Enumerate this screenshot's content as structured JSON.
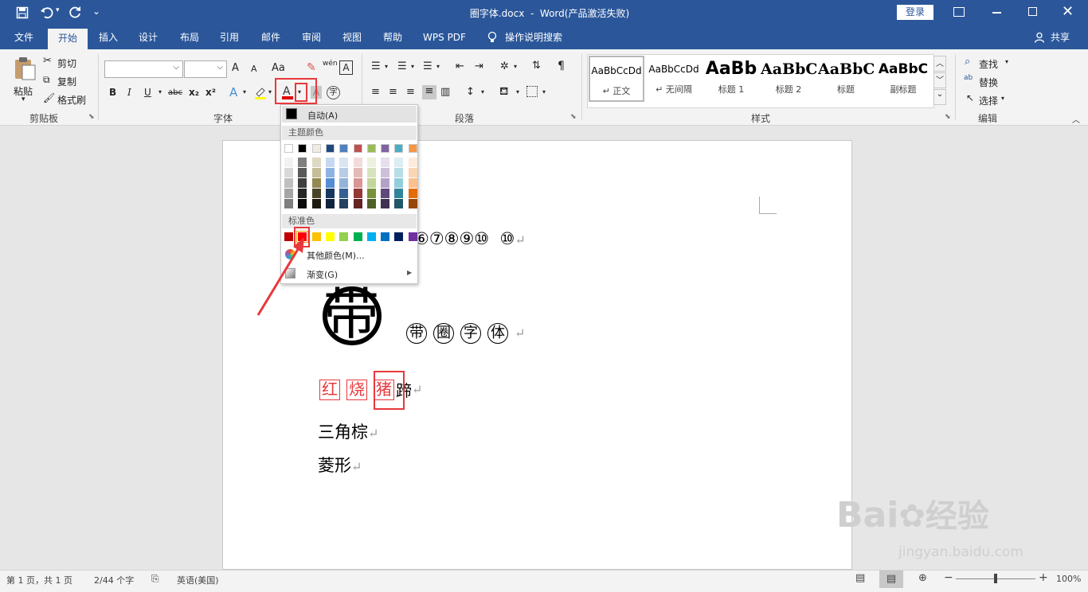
{
  "titlebar": {
    "title": "圈字体.docx  -  Word(产品激活失败)",
    "login": "登录",
    "qat_more": "⌄"
  },
  "tabs": [
    {
      "label": "文件"
    },
    {
      "label": "开始"
    },
    {
      "label": "插入"
    },
    {
      "label": "设计"
    },
    {
      "label": "布局"
    },
    {
      "label": "引用"
    },
    {
      "label": "邮件"
    },
    {
      "label": "审阅"
    },
    {
      "label": "视图"
    },
    {
      "label": "帮助"
    },
    {
      "label": "WPS PDF"
    },
    {
      "label": "操作说明搜索"
    }
  ],
  "share": "共享",
  "clipboard": {
    "paste": "粘贴",
    "cut": "剪切",
    "copy": "复制",
    "format_painter": "格式刷",
    "group": "剪贴板"
  },
  "font": {
    "group": "字体",
    "font_name": "",
    "font_size": "",
    "grow": "A",
    "shrink": "A",
    "change_case": "Aa",
    "phonetic": "wén",
    "bold": "B",
    "italic": "I",
    "underline": "U",
    "strike": "abc",
    "sub": "x₂",
    "sup": "x²",
    "enclose": "字"
  },
  "paragraph": {
    "group": "段落"
  },
  "styles": {
    "group": "样式",
    "items": [
      {
        "sample": "AaBbCcDd",
        "name": "↵ 正文"
      },
      {
        "sample": "AaBbCcDd",
        "name": "↵ 无间隔"
      },
      {
        "sample": "AaBb",
        "name": "标题 1"
      },
      {
        "sample": "AaBbC",
        "name": "标题 2"
      },
      {
        "sample": "AaBbC",
        "name": "标题"
      },
      {
        "sample": "AaBbC",
        "name": "副标题"
      }
    ]
  },
  "editing": {
    "group": "编辑",
    "find": "查找",
    "replace": "替换",
    "select": "选择"
  },
  "color_menu": {
    "auto": "自动(A)",
    "theme_header": "主题颜色",
    "standard_header": "标准色",
    "more": "其他颜色(M)...",
    "gradient": "渐变(G)",
    "theme_top": [
      "#ffffff",
      "#000000",
      "#eeece1",
      "#1f497d",
      "#4f81bd",
      "#c0504d",
      "#9bbb59",
      "#8064a2",
      "#4bacc6",
      "#f79646"
    ],
    "theme_shades": [
      [
        "#f2f2f2",
        "#7f7f7f",
        "#ddd9c3",
        "#c6d9f0",
        "#dbe5f1",
        "#f2dcdb",
        "#ebf1dd",
        "#e5e0ec",
        "#dbeef3",
        "#fdeada"
      ],
      [
        "#d8d8d8",
        "#595959",
        "#c4bd97",
        "#8db3e2",
        "#b8cce4",
        "#e5b9b7",
        "#d7e3bc",
        "#ccc1d9",
        "#b7dde8",
        "#fbd5b5"
      ],
      [
        "#bfbfbf",
        "#3f3f3f",
        "#938953",
        "#548dd4",
        "#95b3d7",
        "#d99694",
        "#c3d69b",
        "#b2a2c7",
        "#92cddc",
        "#fac08f"
      ],
      [
        "#a5a5a5",
        "#262626",
        "#494429",
        "#17365d",
        "#366092",
        "#953734",
        "#76923c",
        "#5f497a",
        "#31859b",
        "#e36c09"
      ],
      [
        "#7f7f7f",
        "#0c0c0c",
        "#1d1b10",
        "#0f243e",
        "#244061",
        "#632423",
        "#4f6128",
        "#3f3151",
        "#205867",
        "#974806"
      ]
    ],
    "standard": [
      "#c00000",
      "#ff0000",
      "#ffc000",
      "#ffff00",
      "#92d050",
      "#00b050",
      "#00b0f0",
      "#0070c0",
      "#002060",
      "#7030a0"
    ]
  },
  "document": {
    "line1": "⑥⑦⑧⑨⑩  ⑩",
    "big_char": "带",
    "circled": [
      "带",
      "圈",
      "字",
      "体"
    ],
    "boxed": [
      "红",
      "烧",
      "猪"
    ],
    "boxed_tail": "蹄",
    "line4": "三角棕",
    "line5": "菱形",
    "mark": "↵"
  },
  "status": {
    "page": "第 1 页，共 1 页",
    "words": "2/44 个字",
    "lang": "英语(美国)",
    "zoom": "100%",
    "zoom_level": 1.0
  },
  "watermark": {
    "brand": "Bai",
    "brand2": "经验",
    "url": "jingyan.baidu.com"
  }
}
